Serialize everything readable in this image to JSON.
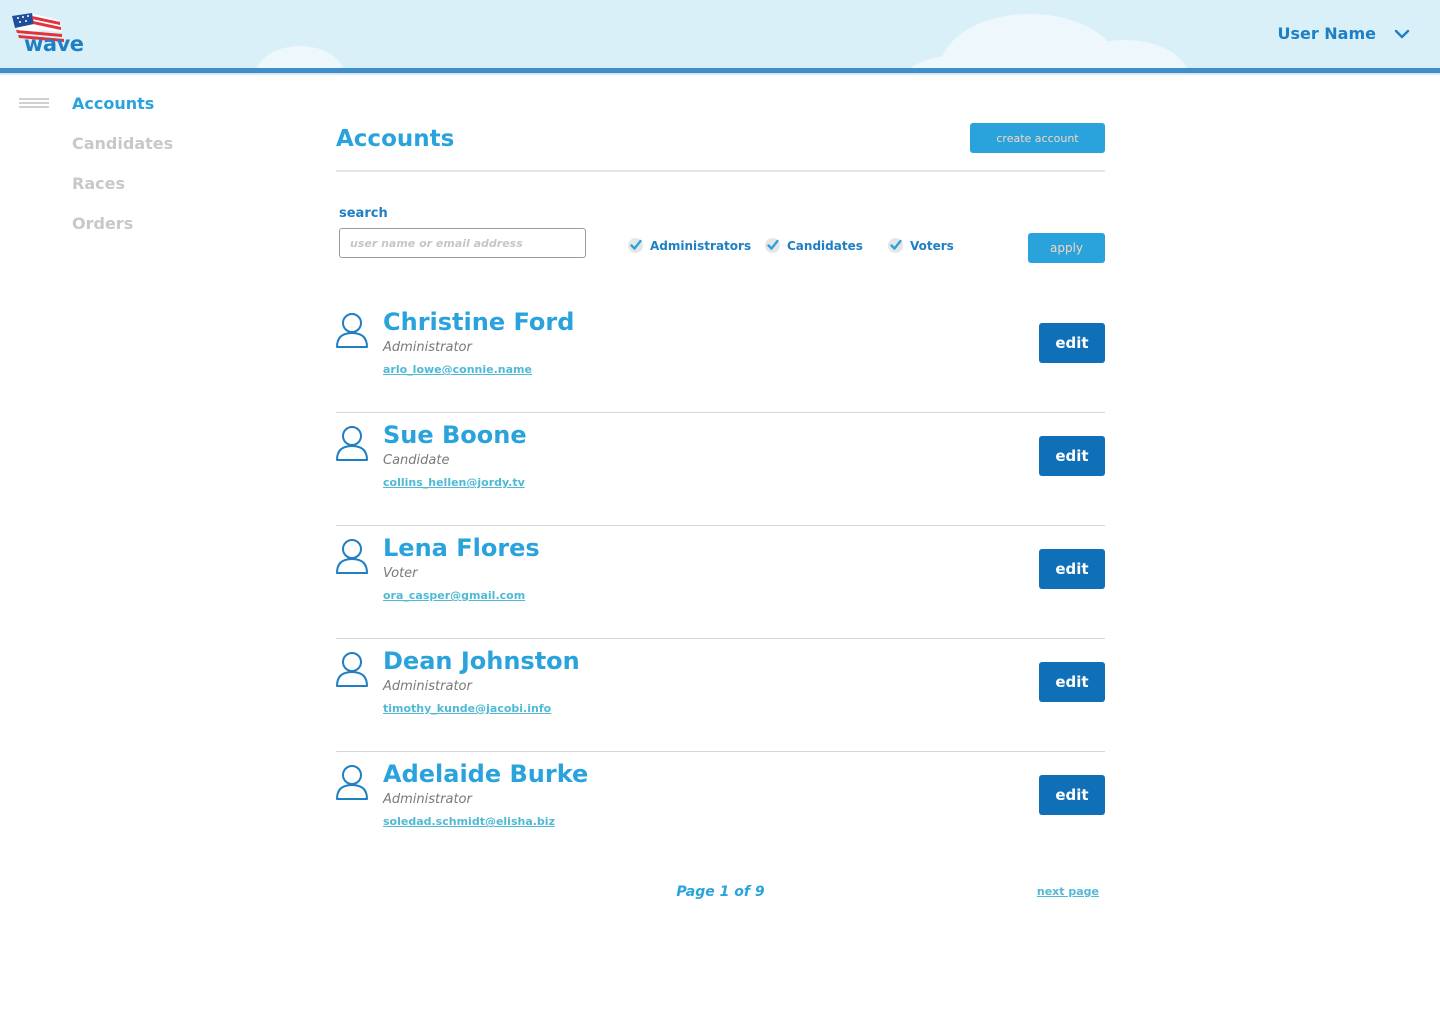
{
  "header": {
    "logo_text": "wave",
    "user_name": "User Name"
  },
  "sidebar": {
    "items": [
      {
        "label": "Accounts",
        "active": true
      },
      {
        "label": "Candidates",
        "active": false
      },
      {
        "label": "Races",
        "active": false
      },
      {
        "label": "Orders",
        "active": false
      }
    ]
  },
  "main": {
    "title": "Accounts",
    "create_label": "create account",
    "search_label": "search",
    "search_placeholder": "user name or email address",
    "search_value": "",
    "filters": [
      {
        "label": "Administrators",
        "checked": true
      },
      {
        "label": "Candidates",
        "checked": true
      },
      {
        "label": "Voters",
        "checked": true
      }
    ],
    "apply_label": "apply",
    "edit_label": "edit",
    "accounts": [
      {
        "name": "Christine Ford",
        "role": "Administrator",
        "email": "arlo_lowe@connie.name"
      },
      {
        "name": "Sue Boone",
        "role": "Candidate",
        "email": "collins_hellen@jordy.tv"
      },
      {
        "name": "Lena Flores",
        "role": "Voter",
        "email": "ora_casper@gmail.com"
      },
      {
        "name": "Dean Johnston",
        "role": "Administrator",
        "email": "timothy_kunde@jacobi.info"
      },
      {
        "name": "Adelaide Burke",
        "role": "Administrator",
        "email": "soledad.schmidt@elisha.biz"
      }
    ],
    "pagination": {
      "page_text": "Page 1 of 9",
      "next_label": "next page"
    }
  },
  "colors": {
    "accent": "#2aa3dc",
    "dark_blue": "#0f6fb7",
    "header_bg": "#d9f0f8",
    "header_bar": "#3e8ec9"
  },
  "icons": [
    "flag-logo-icon",
    "chevron-down-icon",
    "hamburger-icon",
    "checkbox-check-icon",
    "user-avatar-icon"
  ]
}
